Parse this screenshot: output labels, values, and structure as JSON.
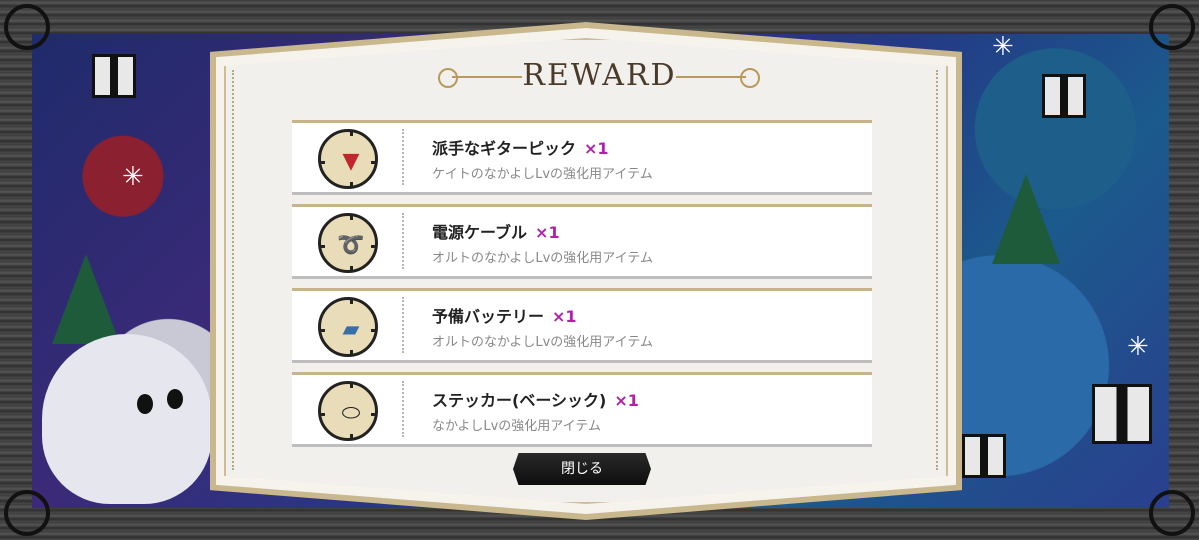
{
  "dialog": {
    "title": "REWARD",
    "close_label": "閉じる"
  },
  "rewards": [
    {
      "name": "派手なギターピック",
      "qty": "×1",
      "desc": "ケイトのなかよしLvの強化用アイテム",
      "icon": "guitar-pick-icon"
    },
    {
      "name": "電源ケーブル",
      "qty": "×1",
      "desc": "オルトのなかよしLvの強化用アイテム",
      "icon": "power-cable-icon"
    },
    {
      "name": "予備バッテリー",
      "qty": "×1",
      "desc": "オルトのなかよしLvの強化用アイテム",
      "icon": "battery-icon"
    },
    {
      "name": "ステッカー(ベーシック)",
      "qty": "×1",
      "desc": "なかよしLvの強化用アイテム",
      "icon": "sticker-icon"
    }
  ],
  "colors": {
    "quantity": "#b21fa8",
    "panel_border": "#c9b78d",
    "button": "#111111"
  }
}
